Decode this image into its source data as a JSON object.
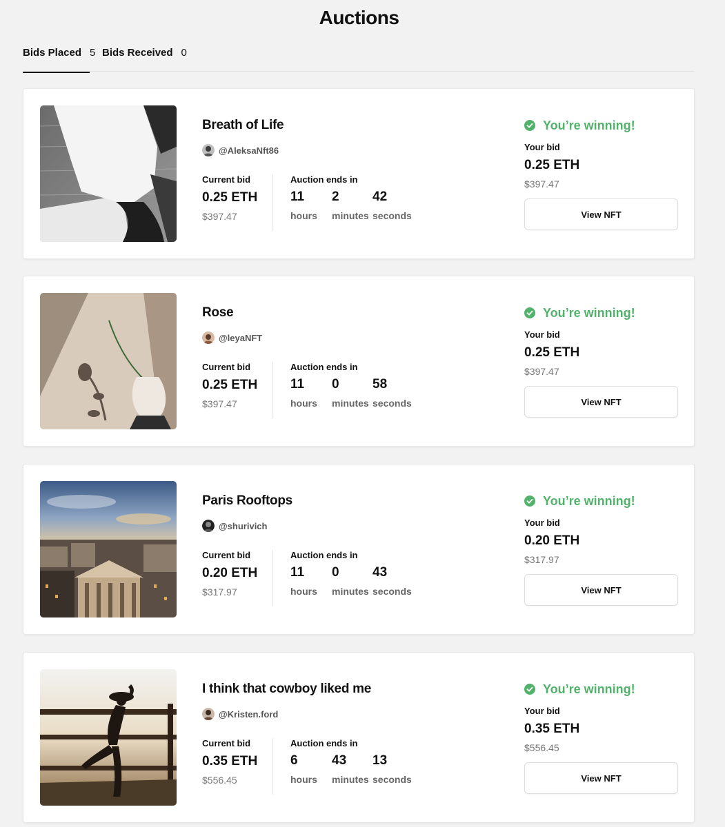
{
  "page": {
    "title": "Auctions"
  },
  "tabs": [
    {
      "label": "Bids Placed",
      "count": "5",
      "active": true
    },
    {
      "label": "Bids Received",
      "count": "0",
      "active": false
    }
  ],
  "labels": {
    "current_bid": "Current bid",
    "auction_ends": "Auction ends in",
    "hours": "hours",
    "minutes": "minutes",
    "seconds": "seconds",
    "status": "You’re winning!",
    "your_bid": "Your bid",
    "view_button": "View NFT"
  },
  "colors": {
    "winning": "#52b26b",
    "background": "#f2f2f2"
  },
  "icons": {
    "status": "check-circle-icon"
  },
  "auctions": [
    {
      "title": "Breath of Life",
      "creator": "@AleksaNft86",
      "current_bid_eth": "0.25 ETH",
      "current_bid_usd": "$397.47",
      "hours": "11",
      "minutes": "2",
      "seconds": "42",
      "your_bid_eth": "0.25 ETH",
      "your_bid_usd": "$397.47"
    },
    {
      "title": "Rose",
      "creator": "@leyaNFT",
      "current_bid_eth": "0.25 ETH",
      "current_bid_usd": "$397.47",
      "hours": "11",
      "minutes": "0",
      "seconds": "58",
      "your_bid_eth": "0.25 ETH",
      "your_bid_usd": "$397.47"
    },
    {
      "title": "Paris Rooftops",
      "creator": "@shurivich",
      "current_bid_eth": "0.20 ETH",
      "current_bid_usd": "$317.97",
      "hours": "11",
      "minutes": "0",
      "seconds": "43",
      "your_bid_eth": "0.20 ETH",
      "your_bid_usd": "$317.97"
    },
    {
      "title": "I think that cowboy liked me",
      "creator": "@Kristen.ford",
      "current_bid_eth": "0.35 ETH",
      "current_bid_usd": "$556.45",
      "hours": "6",
      "minutes": "43",
      "seconds": "13",
      "your_bid_eth": "0.35 ETH",
      "your_bid_usd": "$556.45"
    }
  ]
}
